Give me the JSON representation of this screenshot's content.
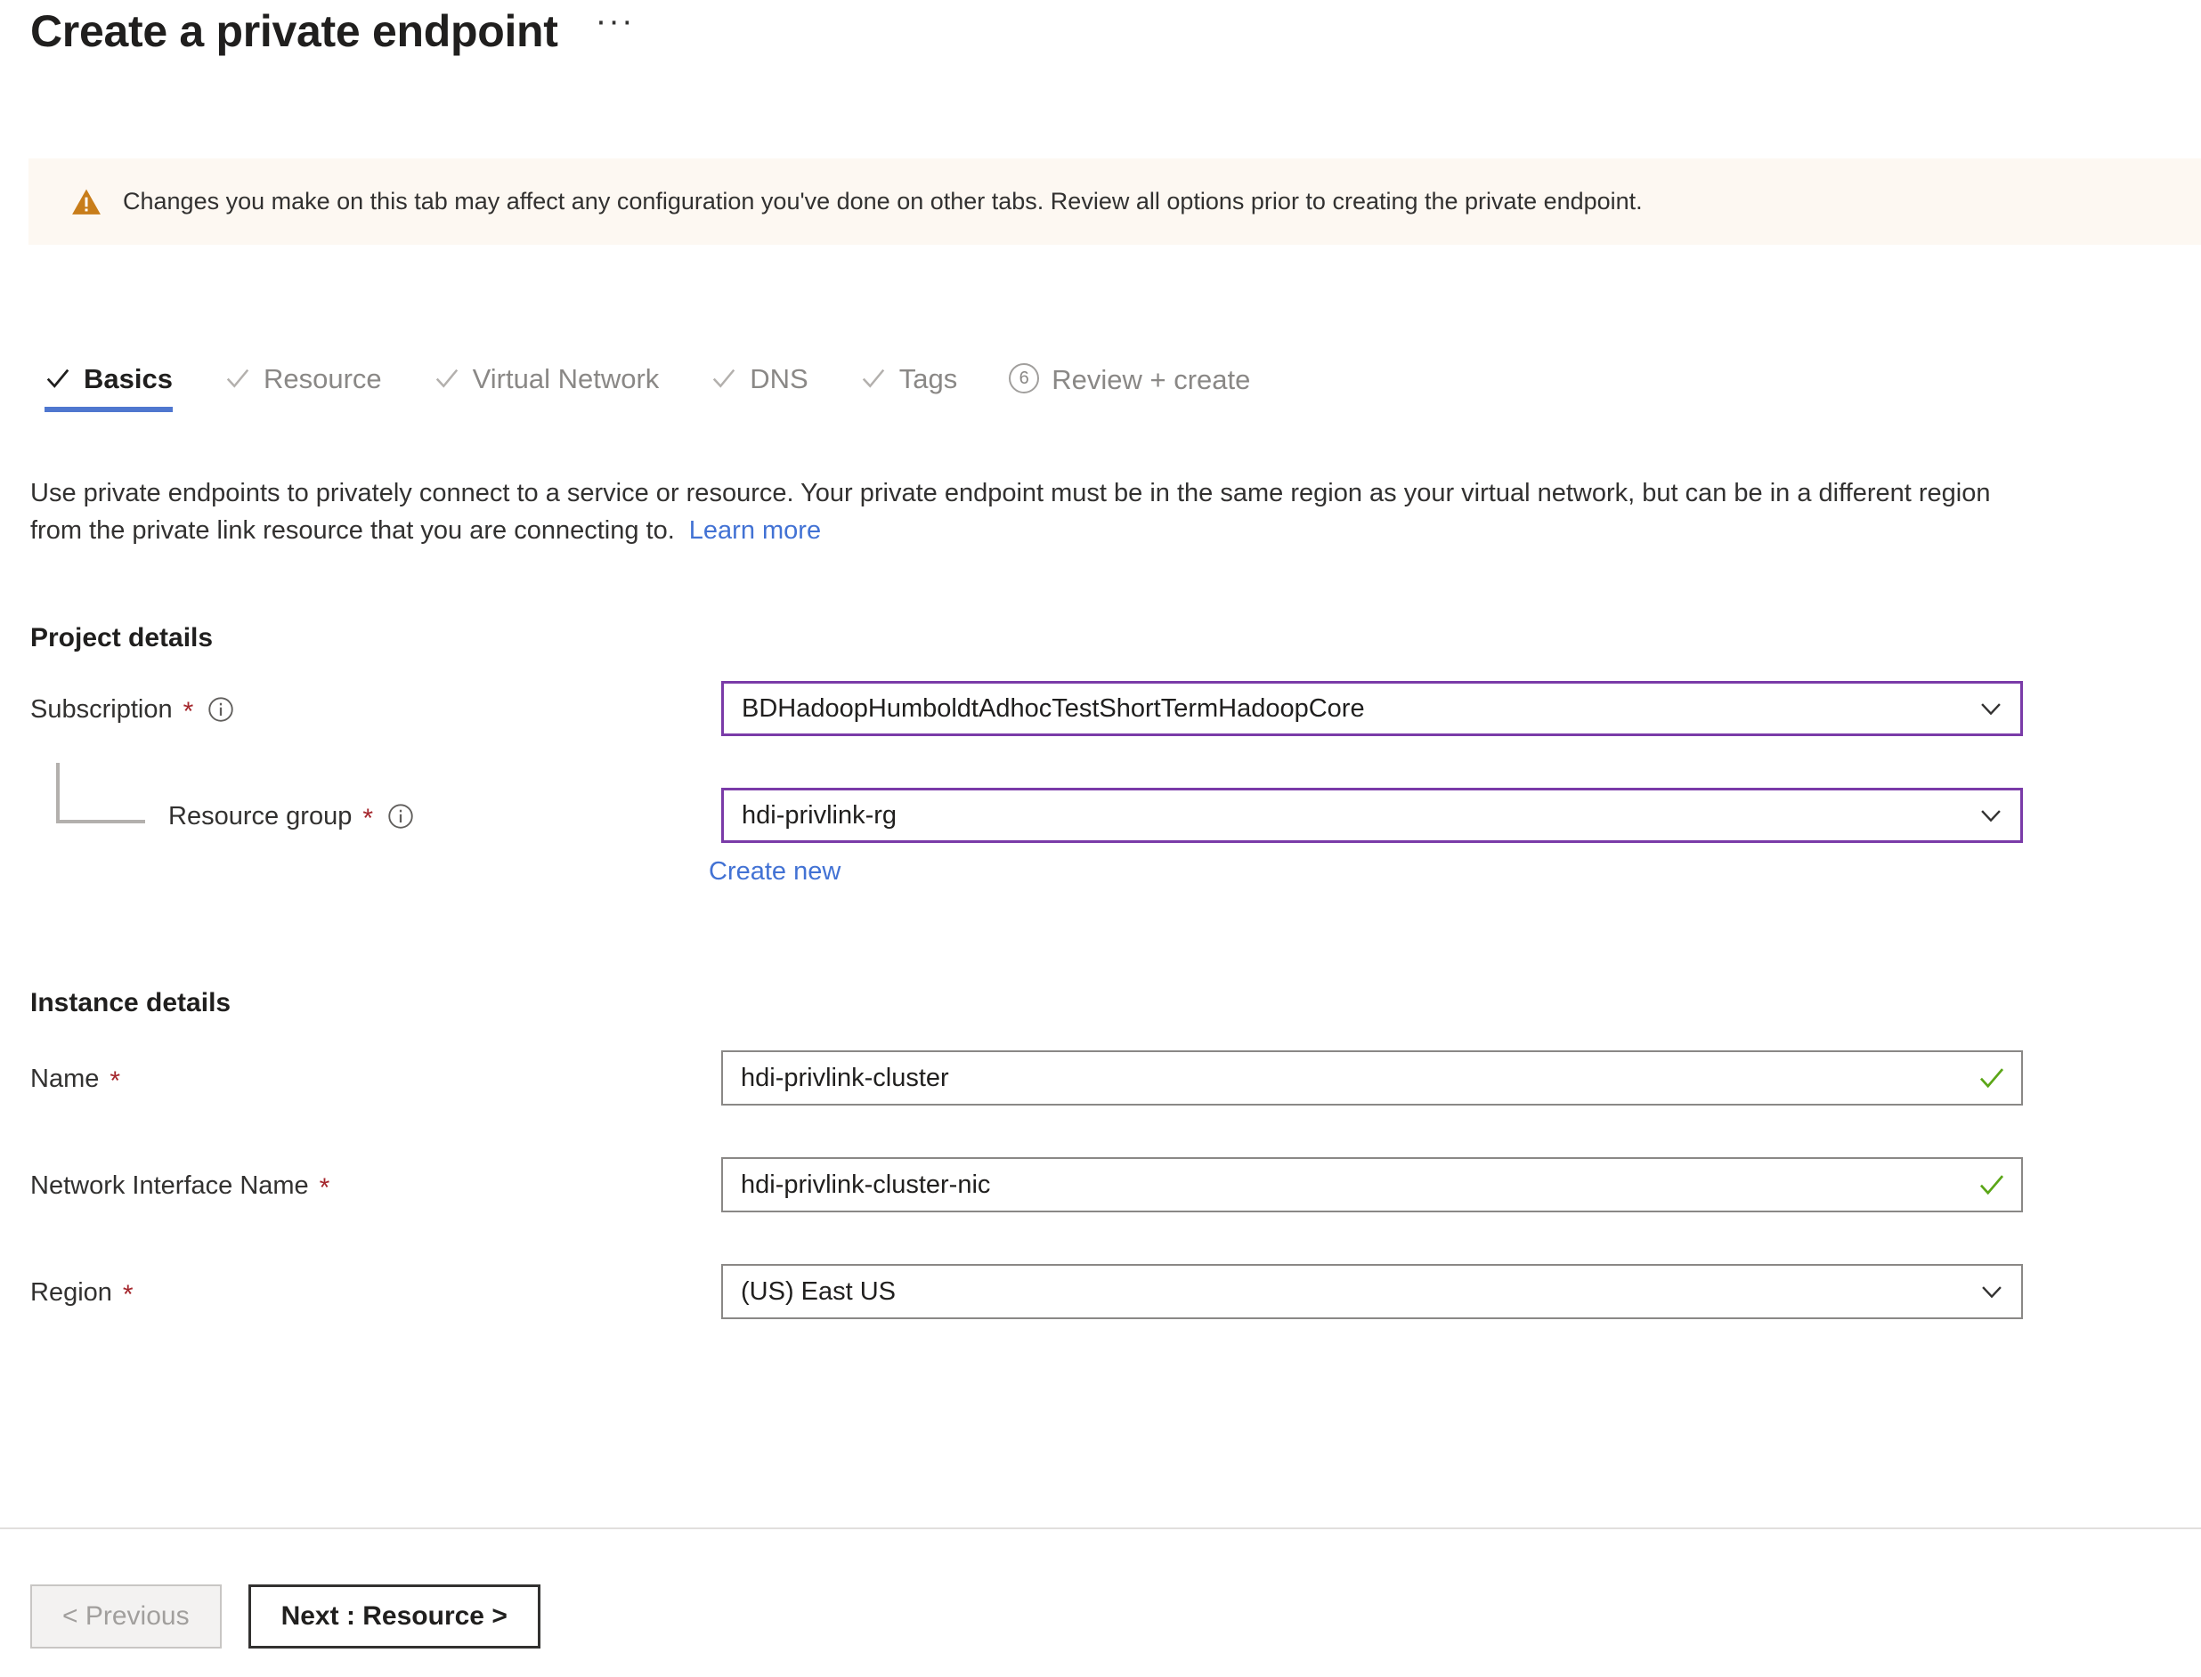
{
  "header": {
    "title": "Create a private endpoint",
    "more_label": "···",
    "more_icon": "ellipsis-icon"
  },
  "banner": {
    "icon": "warning-triangle-icon",
    "icon_color": "#c87d1a",
    "background": "#fdf8f2",
    "text": "Changes you make on this tab may affect any configuration you've done on other tabs. Review all options prior to creating the private endpoint."
  },
  "tabs": {
    "active_index": 0,
    "accent_color": "#4f77cf",
    "items": [
      {
        "label": "Basics",
        "state": "complete",
        "icon": "check-icon",
        "active": true
      },
      {
        "label": "Resource",
        "state": "complete",
        "icon": "check-icon",
        "active": false
      },
      {
        "label": "Virtual Network",
        "state": "complete",
        "icon": "check-icon",
        "active": false
      },
      {
        "label": "DNS",
        "state": "complete",
        "icon": "check-icon",
        "active": false
      },
      {
        "label": "Tags",
        "state": "complete",
        "icon": "check-icon",
        "active": false
      },
      {
        "label": "Review + create",
        "state": "pending",
        "icon": "step-number-badge",
        "badge": "6",
        "active": false
      }
    ]
  },
  "description": {
    "text": "Use private endpoints to privately connect to a service or resource. Your private endpoint must be in the same region as your virtual network, but can be in a different region from the private link resource that you are connecting to.",
    "link_label": "Learn more",
    "link_color": "#4272d4"
  },
  "project_details": {
    "heading": "Project details",
    "subscription": {
      "label": "Subscription",
      "required": "*",
      "info_icon": "info-circle-icon",
      "value": "BDHadoopHumboldtAdhocTestShortTermHadoopCore",
      "control": "dropdown",
      "chevron_icon": "chevron-down-icon",
      "border_color": "#7a3ba8"
    },
    "resource_group": {
      "label": "Resource group",
      "required": "*",
      "info_icon": "info-circle-icon",
      "value": "hdi-privlink-rg",
      "control": "dropdown",
      "chevron_icon": "chevron-down-icon",
      "border_color": "#7a3ba8",
      "create_new_label": "Create new"
    }
  },
  "instance_details": {
    "heading": "Instance details",
    "name": {
      "label": "Name",
      "required": "*",
      "value": "hdi-privlink-cluster",
      "control": "textbox",
      "valid_icon": "check-green-icon",
      "valid_color": "#5ba617",
      "border_color": "#8a8886"
    },
    "network_interface_name": {
      "label": "Network Interface Name",
      "required": "*",
      "value": "hdi-privlink-cluster-nic",
      "control": "textbox",
      "valid_icon": "check-green-icon",
      "valid_color": "#5ba617",
      "border_color": "#8a8886"
    },
    "region": {
      "label": "Region",
      "required": "*",
      "value": "(US) East US",
      "control": "dropdown",
      "chevron_icon": "chevron-down-icon",
      "border_color": "#8a8886"
    }
  },
  "footer": {
    "previous_label": "< Previous",
    "previous_disabled": true,
    "next_label": "Next : Resource >"
  }
}
